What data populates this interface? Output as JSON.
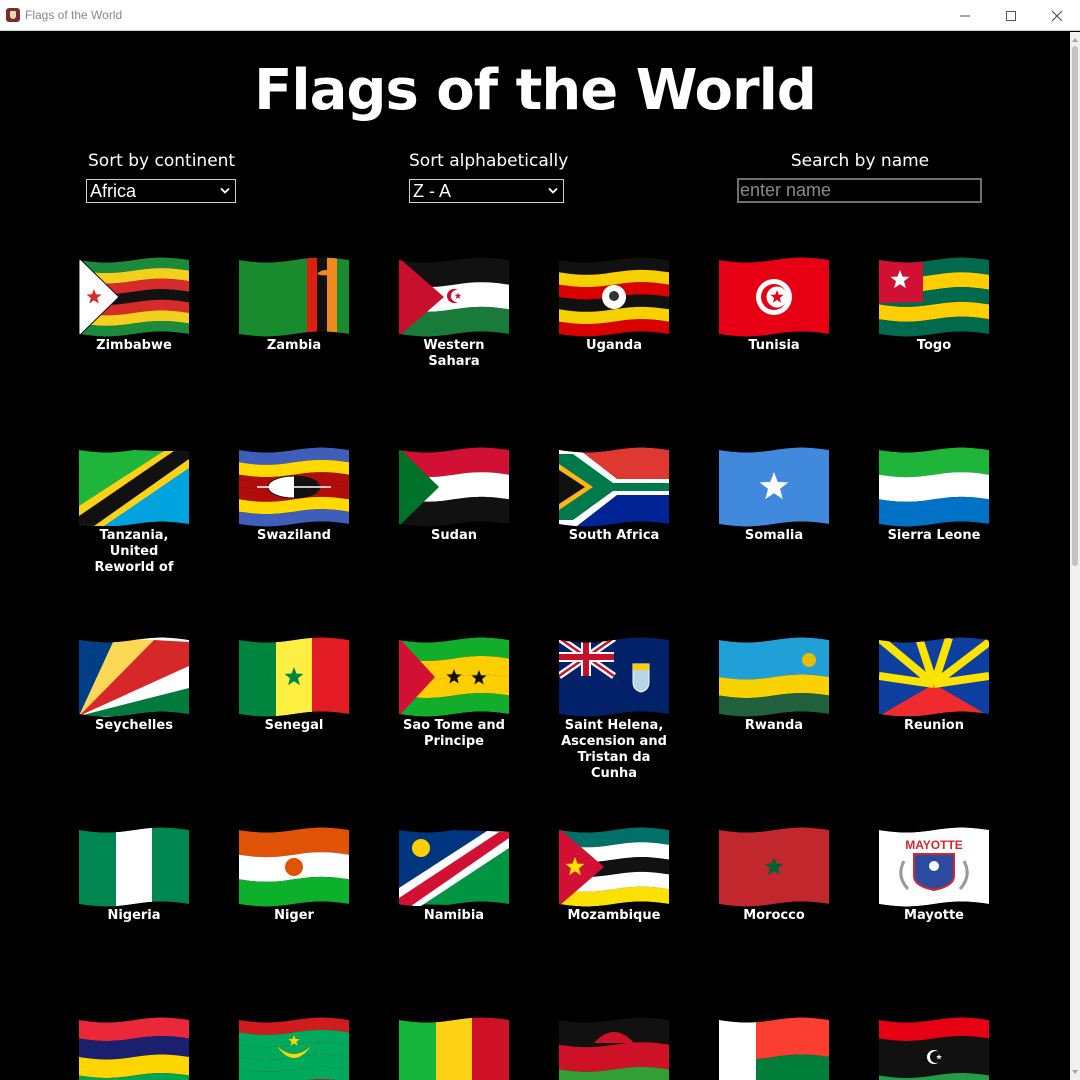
{
  "window": {
    "title": "Flags of the World"
  },
  "page": {
    "title": "Flags of the World"
  },
  "controls": {
    "continent": {
      "label": "Sort by continent",
      "value": "Africa"
    },
    "alphabetical": {
      "label": "Sort alphabetically",
      "value": "Z - A"
    },
    "search": {
      "label": "Search by name",
      "placeholder": "enter name",
      "value": ""
    }
  },
  "flags": [
    {
      "name": "Zimbabwe",
      "icon": "zimbabwe-flag"
    },
    {
      "name": "Zambia",
      "icon": "zambia-flag"
    },
    {
      "name": "Western Sahara",
      "icon": "western-sahara-flag"
    },
    {
      "name": "Uganda",
      "icon": "uganda-flag"
    },
    {
      "name": "Tunisia",
      "icon": "tunisia-flag"
    },
    {
      "name": "Togo",
      "icon": "togo-flag"
    },
    {
      "name": "Tanzania, United Reworld of",
      "icon": "tanzania-flag"
    },
    {
      "name": "Swaziland",
      "icon": "swaziland-flag"
    },
    {
      "name": "Sudan",
      "icon": "sudan-flag"
    },
    {
      "name": "South Africa",
      "icon": "south-africa-flag"
    },
    {
      "name": "Somalia",
      "icon": "somalia-flag"
    },
    {
      "name": "Sierra Leone",
      "icon": "sierra-leone-flag"
    },
    {
      "name": "Seychelles",
      "icon": "seychelles-flag"
    },
    {
      "name": "Senegal",
      "icon": "senegal-flag"
    },
    {
      "name": "Sao Tome and Principe",
      "icon": "sao-tome-flag"
    },
    {
      "name": "Saint Helena, Ascension and Tristan da Cunha",
      "icon": "saint-helena-flag"
    },
    {
      "name": "Rwanda",
      "icon": "rwanda-flag"
    },
    {
      "name": "Reunion",
      "icon": "reunion-flag"
    },
    {
      "name": "Nigeria",
      "icon": "nigeria-flag"
    },
    {
      "name": "Niger",
      "icon": "niger-flag"
    },
    {
      "name": "Namibia",
      "icon": "namibia-flag"
    },
    {
      "name": "Mozambique",
      "icon": "mozambique-flag"
    },
    {
      "name": "Morocco",
      "icon": "morocco-flag"
    },
    {
      "name": "Mayotte",
      "icon": "mayotte-flag",
      "emblem_text": "MAYOTTE"
    },
    {
      "name": "",
      "icon": "mauritius-flag"
    },
    {
      "name": "",
      "icon": "mauritania-flag"
    },
    {
      "name": "",
      "icon": "mali-flag"
    },
    {
      "name": "",
      "icon": "malawi-flag"
    },
    {
      "name": "",
      "icon": "madagascar-flag"
    },
    {
      "name": "",
      "icon": "libya-flag"
    }
  ]
}
